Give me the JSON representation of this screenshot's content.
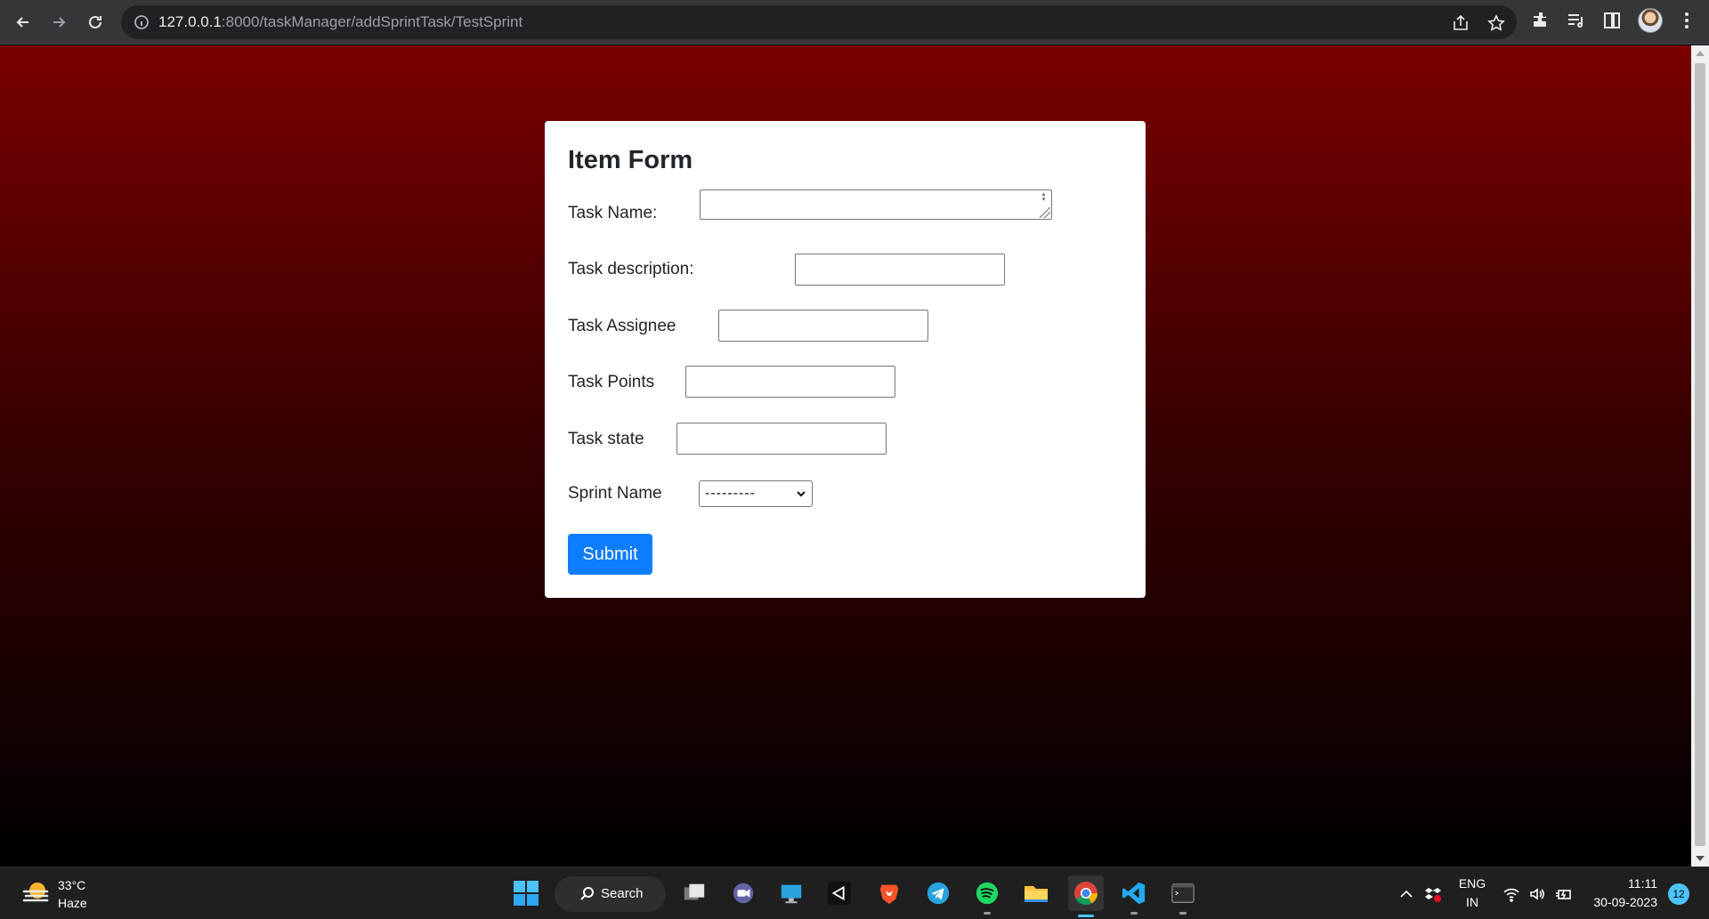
{
  "browser": {
    "url_host": "127.0.0.1",
    "url_rest": ":8000/taskManager/addSprintTask/TestSprint"
  },
  "form": {
    "title": "Item Form",
    "fields": [
      {
        "label": "Task Name:",
        "value": ""
      },
      {
        "label": "Task description:",
        "value": ""
      },
      {
        "label": "Task Assignee",
        "value": ""
      },
      {
        "label": "Task Points",
        "value": ""
      },
      {
        "label": "Task state",
        "value": ""
      }
    ],
    "sprint": {
      "label": "Sprint Name",
      "selected": "---------"
    },
    "submit_label": "Submit"
  },
  "taskbar": {
    "weather_temp": "33°C",
    "weather_desc": "Haze",
    "search_label": "Search",
    "lang_top": "ENG",
    "lang_bottom": "IN",
    "time": "11:11",
    "date": "30-09-2023",
    "notification_count": "12"
  },
  "colors": {
    "accent": "#0d7dff",
    "page_gradient_top": "#7a0000",
    "page_gradient_bottom": "#000000"
  }
}
